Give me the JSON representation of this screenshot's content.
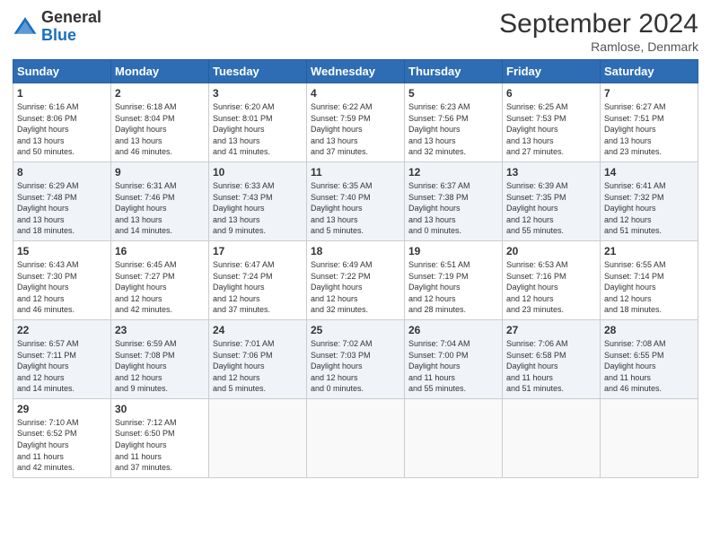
{
  "header": {
    "logo_general": "General",
    "logo_blue": "Blue",
    "month_year": "September 2024",
    "location": "Ramlose, Denmark"
  },
  "days_of_week": [
    "Sunday",
    "Monday",
    "Tuesday",
    "Wednesday",
    "Thursday",
    "Friday",
    "Saturday"
  ],
  "weeks": [
    [
      {
        "day": "1",
        "sunrise": "6:16 AM",
        "sunset": "8:06 PM",
        "daylight": "13 hours and 50 minutes."
      },
      {
        "day": "2",
        "sunrise": "6:18 AM",
        "sunset": "8:04 PM",
        "daylight": "13 hours and 46 minutes."
      },
      {
        "day": "3",
        "sunrise": "6:20 AM",
        "sunset": "8:01 PM",
        "daylight": "13 hours and 41 minutes."
      },
      {
        "day": "4",
        "sunrise": "6:22 AM",
        "sunset": "7:59 PM",
        "daylight": "13 hours and 37 minutes."
      },
      {
        "day": "5",
        "sunrise": "6:23 AM",
        "sunset": "7:56 PM",
        "daylight": "13 hours and 32 minutes."
      },
      {
        "day": "6",
        "sunrise": "6:25 AM",
        "sunset": "7:53 PM",
        "daylight": "13 hours and 27 minutes."
      },
      {
        "day": "7",
        "sunrise": "6:27 AM",
        "sunset": "7:51 PM",
        "daylight": "13 hours and 23 minutes."
      }
    ],
    [
      {
        "day": "8",
        "sunrise": "6:29 AM",
        "sunset": "7:48 PM",
        "daylight": "13 hours and 18 minutes."
      },
      {
        "day": "9",
        "sunrise": "6:31 AM",
        "sunset": "7:46 PM",
        "daylight": "13 hours and 14 minutes."
      },
      {
        "day": "10",
        "sunrise": "6:33 AM",
        "sunset": "7:43 PM",
        "daylight": "13 hours and 9 minutes."
      },
      {
        "day": "11",
        "sunrise": "6:35 AM",
        "sunset": "7:40 PM",
        "daylight": "13 hours and 5 minutes."
      },
      {
        "day": "12",
        "sunrise": "6:37 AM",
        "sunset": "7:38 PM",
        "daylight": "13 hours and 0 minutes."
      },
      {
        "day": "13",
        "sunrise": "6:39 AM",
        "sunset": "7:35 PM",
        "daylight": "12 hours and 55 minutes."
      },
      {
        "day": "14",
        "sunrise": "6:41 AM",
        "sunset": "7:32 PM",
        "daylight": "12 hours and 51 minutes."
      }
    ],
    [
      {
        "day": "15",
        "sunrise": "6:43 AM",
        "sunset": "7:30 PM",
        "daylight": "12 hours and 46 minutes."
      },
      {
        "day": "16",
        "sunrise": "6:45 AM",
        "sunset": "7:27 PM",
        "daylight": "12 hours and 42 minutes."
      },
      {
        "day": "17",
        "sunrise": "6:47 AM",
        "sunset": "7:24 PM",
        "daylight": "12 hours and 37 minutes."
      },
      {
        "day": "18",
        "sunrise": "6:49 AM",
        "sunset": "7:22 PM",
        "daylight": "12 hours and 32 minutes."
      },
      {
        "day": "19",
        "sunrise": "6:51 AM",
        "sunset": "7:19 PM",
        "daylight": "12 hours and 28 minutes."
      },
      {
        "day": "20",
        "sunrise": "6:53 AM",
        "sunset": "7:16 PM",
        "daylight": "12 hours and 23 minutes."
      },
      {
        "day": "21",
        "sunrise": "6:55 AM",
        "sunset": "7:14 PM",
        "daylight": "12 hours and 18 minutes."
      }
    ],
    [
      {
        "day": "22",
        "sunrise": "6:57 AM",
        "sunset": "7:11 PM",
        "daylight": "12 hours and 14 minutes."
      },
      {
        "day": "23",
        "sunrise": "6:59 AM",
        "sunset": "7:08 PM",
        "daylight": "12 hours and 9 minutes."
      },
      {
        "day": "24",
        "sunrise": "7:01 AM",
        "sunset": "7:06 PM",
        "daylight": "12 hours and 5 minutes."
      },
      {
        "day": "25",
        "sunrise": "7:02 AM",
        "sunset": "7:03 PM",
        "daylight": "12 hours and 0 minutes."
      },
      {
        "day": "26",
        "sunrise": "7:04 AM",
        "sunset": "7:00 PM",
        "daylight": "11 hours and 55 minutes."
      },
      {
        "day": "27",
        "sunrise": "7:06 AM",
        "sunset": "6:58 PM",
        "daylight": "11 hours and 51 minutes."
      },
      {
        "day": "28",
        "sunrise": "7:08 AM",
        "sunset": "6:55 PM",
        "daylight": "11 hours and 46 minutes."
      }
    ],
    [
      {
        "day": "29",
        "sunrise": "7:10 AM",
        "sunset": "6:52 PM",
        "daylight": "11 hours and 42 minutes."
      },
      {
        "day": "30",
        "sunrise": "7:12 AM",
        "sunset": "6:50 PM",
        "daylight": "11 hours and 37 minutes."
      },
      null,
      null,
      null,
      null,
      null
    ]
  ]
}
